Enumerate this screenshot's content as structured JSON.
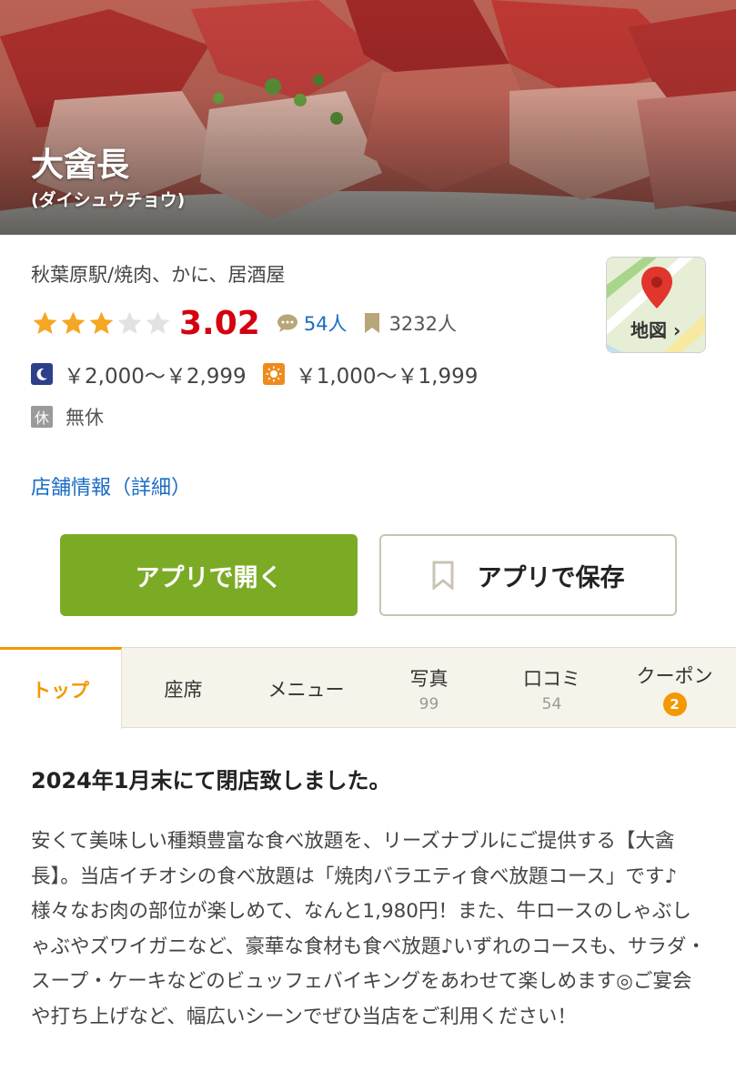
{
  "hero": {
    "shop_name": "大酓長",
    "shop_kana": "(ダイシュウチョウ)"
  },
  "info": {
    "station_genre": "秋葉原駅/焼肉、かに、居酒屋",
    "rating": {
      "stars_filled": 3,
      "stars_total": 5,
      "score": "3.02",
      "review_count": "54人",
      "bookmark_count": "3232人"
    },
    "budget": {
      "dinner": "￥2,000～￥2,999",
      "lunch": "￥1,000～￥1,999"
    },
    "holiday": {
      "badge": "休",
      "text": "無休"
    },
    "map_label": "地図",
    "detail_link": "店舗情報（詳細）"
  },
  "actions": {
    "open_app": "アプリで開く",
    "save_app": "アプリで保存"
  },
  "tabs": [
    {
      "label": "トップ",
      "sub": "",
      "active": true
    },
    {
      "label": "座席",
      "sub": ""
    },
    {
      "label": "メニュー",
      "sub": ""
    },
    {
      "label": "写真",
      "sub": "99"
    },
    {
      "label": "口コミ",
      "sub": "54"
    },
    {
      "label": "クーポン",
      "badge": "2"
    }
  ],
  "content": {
    "notice": "2024年1月末にて閉店致しました。",
    "description": "安くて美味しい種類豊富な食べ放題を、リーズナブルにご提供する【大酓長】。当店イチオシの食べ放題は「焼肉バラエティ食べ放題コース」です♪様々なお肉の部位が楽しめて、なんと1,980円！また、牛ロースのしゃぶしゃぶやズワイガニなど、豪華な食材も食べ放題♪いずれのコースも、サラダ・スープ・ケーキなどのビュッフェバイキングをあわせて楽しめます◎ご宴会や打ち上げなど、幅広いシーンでぜひ当店をご利用ください！"
  },
  "colors": {
    "score_red": "#d4000f",
    "link_blue": "#1a6cc4",
    "open_green": "#7bab25",
    "tab_orange": "#f39800"
  }
}
